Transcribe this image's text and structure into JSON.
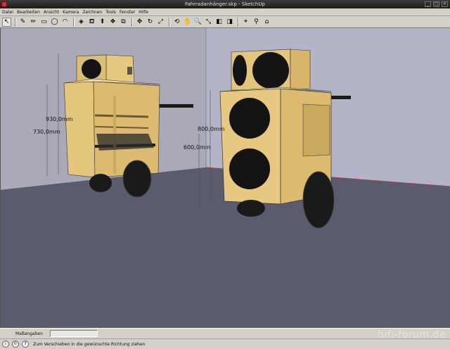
{
  "window": {
    "title": "Fahrradanhänger.skp - SketchUp"
  },
  "menu": [
    "Datei",
    "Bearbeiten",
    "Ansicht",
    "Kamera",
    "Zeichnen",
    "Tools",
    "Fenster",
    "Hilfe"
  ],
  "toolbar": {
    "icons": [
      {
        "name": "select-icon",
        "glyph": "↖",
        "active": true
      },
      {
        "name": "eraser-icon",
        "glyph": "✎"
      },
      {
        "name": "pencil-icon",
        "glyph": "✏"
      },
      {
        "name": "rectangle-icon",
        "glyph": "▭"
      },
      {
        "name": "circle-icon",
        "glyph": "◯"
      },
      {
        "name": "arc-icon",
        "glyph": "◠"
      },
      {
        "name": "make-component-icon",
        "glyph": "◈"
      },
      {
        "name": "paint-bucket-icon",
        "glyph": "⛾"
      },
      {
        "name": "push-pull-icon",
        "glyph": "⬆"
      },
      {
        "name": "follow-me-icon",
        "glyph": "❖"
      },
      {
        "name": "offset-icon",
        "glyph": "⧉"
      },
      {
        "name": "move-icon",
        "glyph": "✥"
      },
      {
        "name": "rotate-icon",
        "glyph": "↻"
      },
      {
        "name": "scale-icon",
        "glyph": "⤢"
      },
      {
        "name": "orbit-icon",
        "glyph": "⟲"
      },
      {
        "name": "pan-icon",
        "glyph": "✋"
      },
      {
        "name": "zoom-icon",
        "glyph": "🔍"
      },
      {
        "name": "zoom-extents-icon",
        "glyph": "⤡"
      },
      {
        "name": "previous-view-icon",
        "glyph": "◧"
      },
      {
        "name": "next-view-icon",
        "glyph": "◨"
      },
      {
        "name": "place-camera-icon",
        "glyph": "⌖"
      },
      {
        "name": "walk-icon",
        "glyph": "⚲"
      },
      {
        "name": "get-models-icon",
        "glyph": "⌂"
      }
    ]
  },
  "viewport": {
    "dimensions": [
      "930,0mm",
      "730,0mm",
      "800,0mm",
      "600,0mm"
    ],
    "colors": {
      "wall_left": "#a9a9b8",
      "wall_right": "#b1b1c4",
      "floor": "#5b5b6e",
      "plywood": "#e2c47c",
      "speaker": "#141414",
      "wheel": "#1a1a1a"
    }
  },
  "measurebar": {
    "label": "Maßangaben",
    "value": ""
  },
  "statusbar": {
    "text": "Zum Verschieben in die gewünschte Richtung ziehen"
  },
  "watermark": "hifi-forum.de"
}
